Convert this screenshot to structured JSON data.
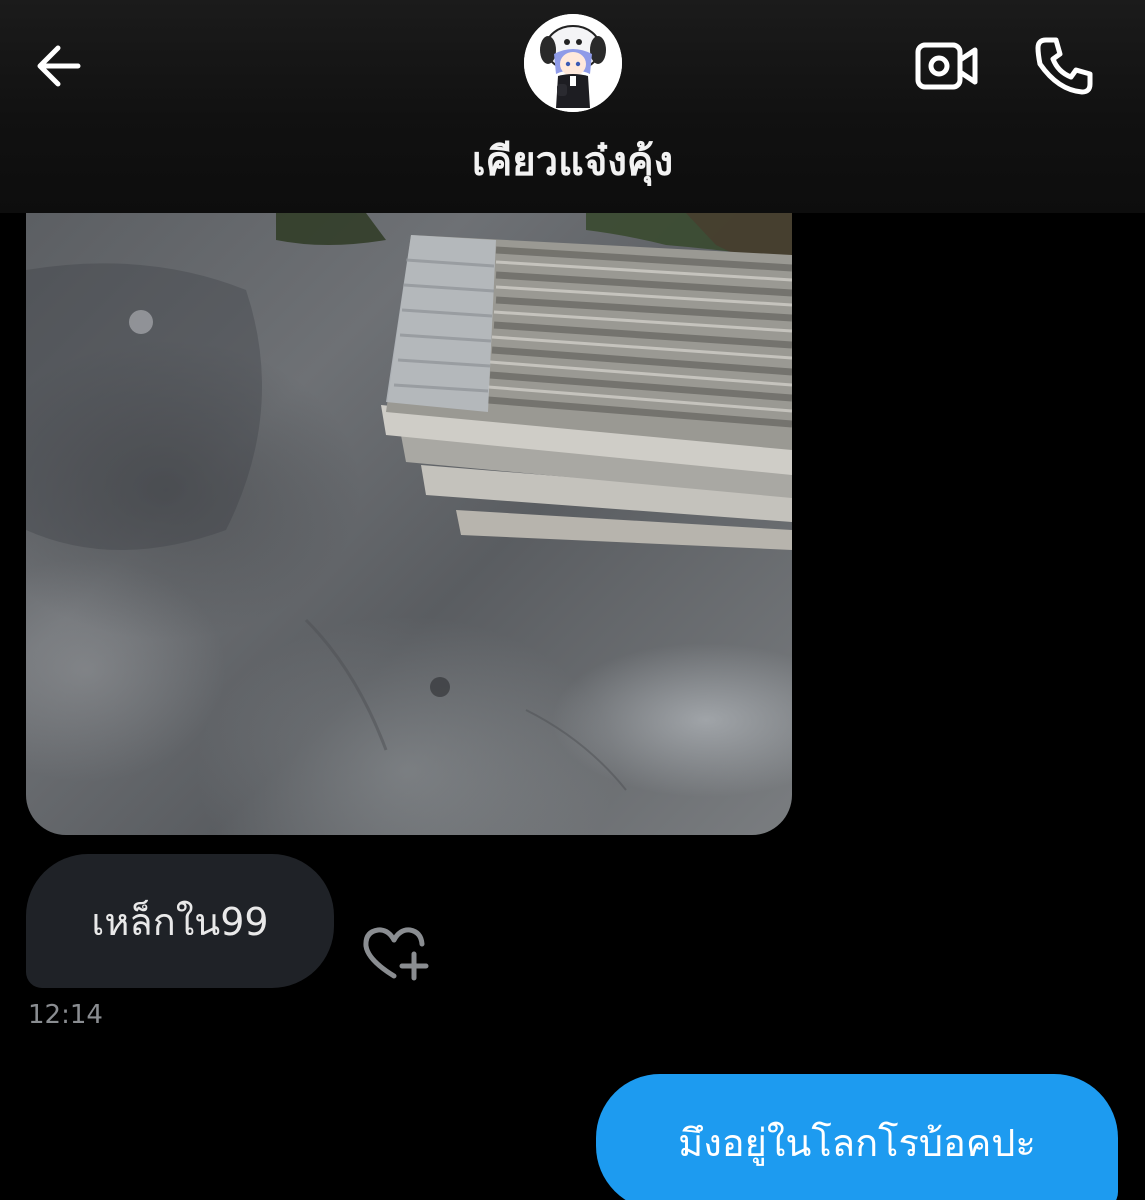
{
  "header": {
    "back_icon": "arrow-left-icon",
    "contact_name": "เคียวแจ๋งคุ้ง",
    "avatar_icon": "contact-avatar",
    "video_icon": "video-camera-icon",
    "call_icon": "phone-icon"
  },
  "messages": [
    {
      "type": "image",
      "direction": "incoming",
      "image_icon": "photo-corrugated-metal-sheets"
    },
    {
      "type": "text",
      "direction": "incoming",
      "text": "เหล็กใน99"
    },
    {
      "type": "timestamp",
      "text": "12:14"
    },
    {
      "type": "text",
      "direction": "outgoing",
      "text": "มึงอยู่ในโลกโรบ้อคปะ"
    }
  ],
  "reaction_icon": "heart-plus-icon",
  "colors": {
    "background": "#000000",
    "header": "#141414",
    "incoming_bubble": "#1f2227",
    "outgoing_bubble": "#1d9bf0",
    "timestamp": "#8a8d91"
  }
}
